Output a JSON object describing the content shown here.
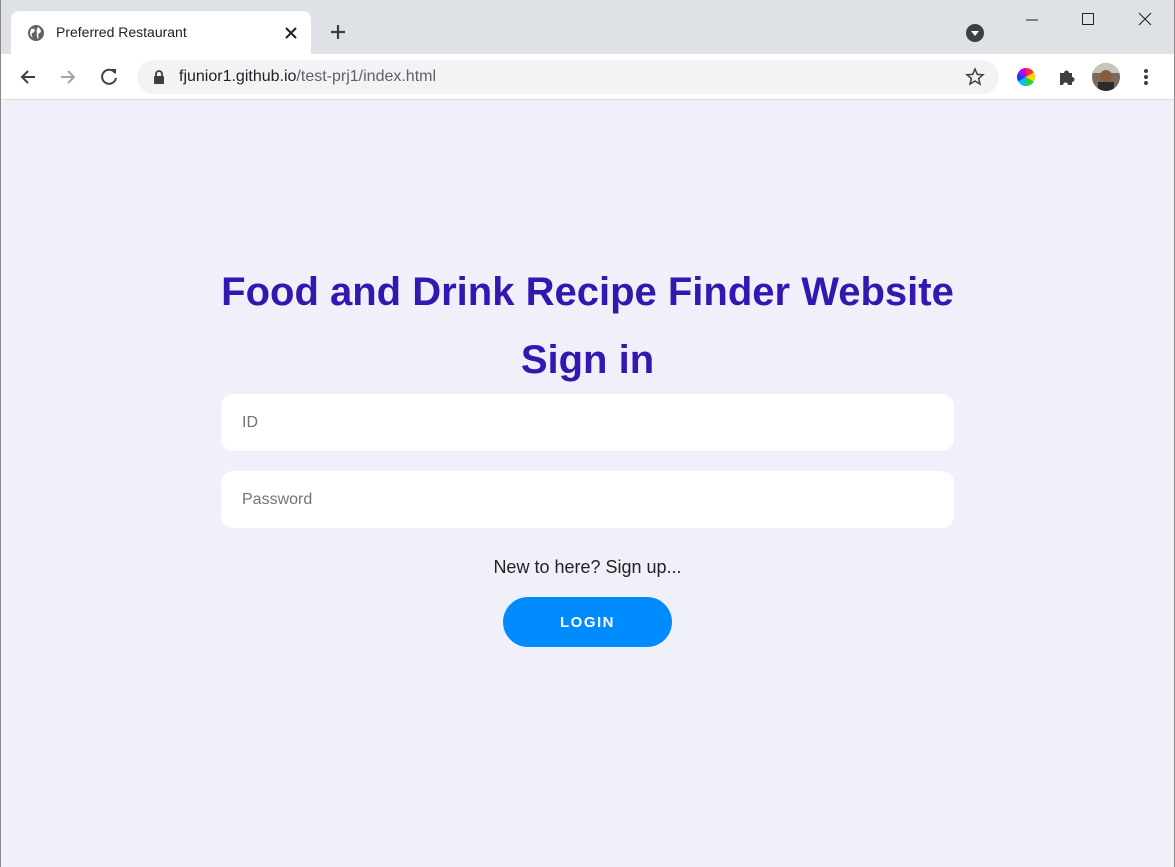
{
  "browser": {
    "tab": {
      "title": "Preferred Restaurant",
      "favicon": "globe-icon",
      "close_icon": "close-icon"
    },
    "new_tab_icon": "plus-icon",
    "tab_search_icon": "chevron-down-circle-icon",
    "window_controls": [
      "minimize-icon",
      "maximize-icon",
      "close-icon"
    ],
    "nav": {
      "back_icon": "arrow-left-icon",
      "forward_icon": "arrow-right-icon",
      "reload_icon": "reload-icon"
    },
    "address_bar": {
      "host": "fjunior1.github.io",
      "path": "/test-prj1/index.html",
      "lock_icon": "lock-icon",
      "bookmark_icon": "star-icon"
    },
    "extensions": [
      "color-wheel-icon",
      "puzzle-icon"
    ],
    "menu_icon": "kebab-menu-icon"
  },
  "page": {
    "site_title": "Food and Drink Recipe Finder Website",
    "signin_title": "Sign in",
    "id_placeholder": "ID",
    "password_placeholder": "Password",
    "signup_text": "New to here? Sign up...",
    "login_label": "LOGIN",
    "colors": {
      "background": "#f0f0fa",
      "heading": "#3317b0",
      "login_button": "#008cff"
    }
  }
}
